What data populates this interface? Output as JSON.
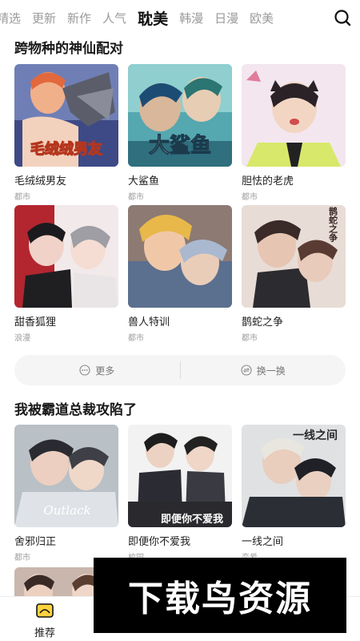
{
  "nav": {
    "tabs": [
      "精选",
      "更新",
      "新作",
      "人气",
      "耽美",
      "韩漫",
      "日漫",
      "欧美"
    ],
    "active_tab": "耽美",
    "search_icon": "search-icon"
  },
  "sections": [
    {
      "title": "跨物种的神仙配对",
      "items": [
        {
          "title": "毛绒绒男友",
          "tag": "都市",
          "cover_text": "毛绒绒男友"
        },
        {
          "title": "大鲨鱼",
          "tag": "都市",
          "cover_text": "大鲨鱼"
        },
        {
          "title": "胆怯的老虎",
          "tag": "都市",
          "cover_text": ""
        },
        {
          "title": "甜香狐狸",
          "tag": "浪漫",
          "cover_text": ""
        },
        {
          "title": "兽人特训",
          "tag": "都市",
          "cover_text": ""
        },
        {
          "title": "鹊蛇之争",
          "tag": "都市",
          "cover_text": "鹊蛇之争"
        }
      ]
    },
    {
      "title": "我被霸道总裁攻陷了",
      "items": [
        {
          "title": "舍邪归正",
          "tag": "都市",
          "cover_text": "Outlack"
        },
        {
          "title": "即便你不爱我",
          "tag": "校园",
          "cover_text": "即便你不爱我"
        },
        {
          "title": "一线之间",
          "tag": "恋爱",
          "cover_text": "一线之间"
        }
      ]
    }
  ],
  "actions": {
    "more_label": "更多",
    "refresh_label": "换一换"
  },
  "bottom_nav": {
    "recommend_label": "推荐"
  },
  "watermark": "下载鸟资源",
  "colors": {
    "accent": "#111111",
    "muted": "#9a9a9a"
  }
}
